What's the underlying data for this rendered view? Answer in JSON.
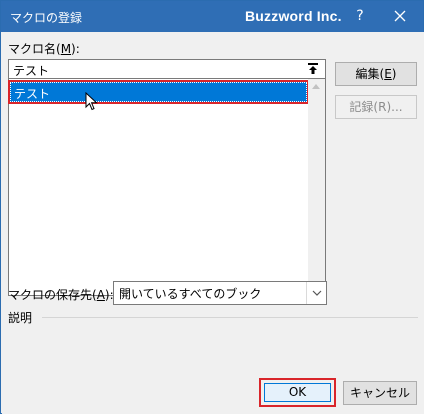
{
  "titlebar": {
    "title": "マクロの登録",
    "brand": "Buzzword Inc.",
    "help": "?"
  },
  "macro_name": {
    "label_prefix": "マクロ名(",
    "label_key": "M",
    "label_suffix": "):",
    "value": "テスト"
  },
  "macro_list": {
    "items": [
      "テスト"
    ],
    "selected_index": 0
  },
  "buttons": {
    "edit_prefix": "編集(",
    "edit_key": "E",
    "edit_suffix": ")",
    "record": "記録(R)...",
    "ok": "OK",
    "cancel": "キャンセル"
  },
  "location": {
    "label_prefix": "マクロの保存先(",
    "label_key": "A",
    "label_suffix": "):",
    "selected": "開いているすべてのブック"
  },
  "description": {
    "label": "説明"
  },
  "colors": {
    "titlebar": "#2f6eb5",
    "selection": "#0078d7",
    "highlight_box": "#d9252a"
  }
}
